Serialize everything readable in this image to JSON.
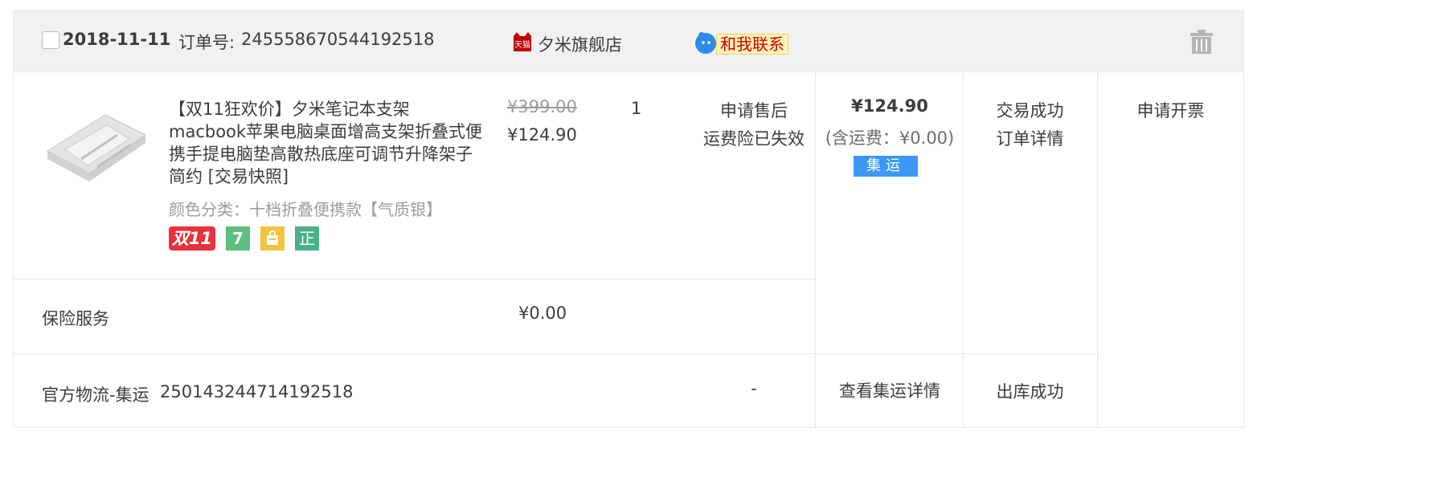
{
  "header": {
    "date": "2018-11-11",
    "order_label": "订单号:",
    "order_number": "245558670544192518",
    "tmall_icon": "tmall-cat-icon",
    "shop_name": "夕米旗舰店",
    "contact_label": "和我联系"
  },
  "product": {
    "title": "【双11狂欢价】夕米笔记本支架macbook苹果电脑桌面增高支架折叠式便携手提电脑垫高散热底座可调节升降架子简约 [交易快照]",
    "sku": "颜色分类：十档折叠便携款【气质银】",
    "badges": {
      "double11": "双11",
      "seven": "7",
      "zheng": "正"
    },
    "original_price": "¥399.00",
    "price": "¥124.90",
    "quantity": "1",
    "after_sale": "申请售后",
    "insurance_status": "运费险已失效"
  },
  "summary": {
    "total": "¥124.90",
    "shipping": "(含运费：¥0.00)",
    "jiyun_badge": "集运",
    "status": "交易成功",
    "detail_link": "订单详情",
    "invoice": "申请开票"
  },
  "insurance": {
    "label": "保险服务",
    "price": "¥0.00"
  },
  "logistics": {
    "label": "官方物流-集运",
    "number": "250143244714192518",
    "dash": "-",
    "detail": "查看集运详情",
    "status": "出库成功"
  },
  "colors": {
    "header_bg": "#f1f1f1",
    "border": "#e8e8e8",
    "jiyun_blue": "#3b98f5",
    "double11_red": "#e8333b"
  }
}
